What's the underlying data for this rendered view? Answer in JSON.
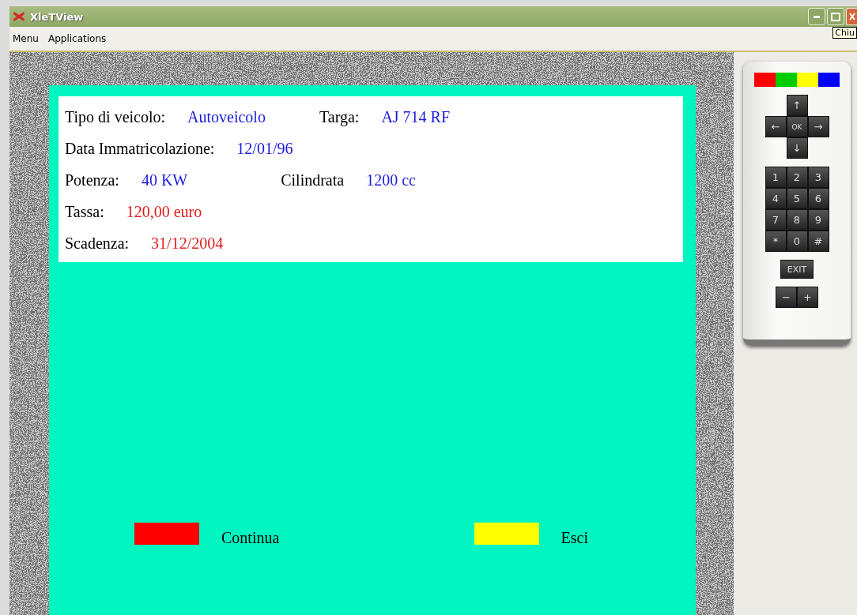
{
  "window": {
    "title": "XleTView",
    "tooltip": "Chiu"
  },
  "menu_bar": [
    "Menu",
    "Applications"
  ],
  "vehicle_info": [
    {
      "fields": [
        {
          "label": "Tipo di veicolo:",
          "value": "Autoveicolo",
          "color": "#1a1adc"
        },
        {
          "label": "Targa:",
          "value": "AJ 714 RF",
          "color": "#1a1adc"
        }
      ]
    },
    {
      "fields": [
        {
          "label": "Data Immatricolazione:",
          "value": "12/01/96",
          "color": "#1a1adc"
        }
      ]
    },
    {
      "fields": [
        {
          "label": "Potenza:",
          "value": "40 KW",
          "color": "#1a1adc"
        },
        {
          "label": "Cilindrata",
          "value": "1200 cc",
          "color": "#1a1adc"
        }
      ]
    },
    {
      "fields": [
        {
          "label": "Tassa:",
          "value": "120,00 euro",
          "color": "#e01a1a"
        }
      ]
    },
    {
      "fields": [
        {
          "label": "Scadenza:",
          "value": "31/12/2004",
          "color": "#e01a1a"
        }
      ]
    }
  ],
  "actions": [
    {
      "label": "Continua",
      "color": "#ff0000"
    },
    {
      "label": "Esci",
      "color": "#ffff00"
    }
  ],
  "remote": {
    "color_keys": [
      {
        "color": "#ff0000"
      },
      {
        "color": "#00cc00"
      },
      {
        "color": "#ffff00"
      },
      {
        "color": "#0000ff"
      }
    ],
    "dpad": {
      "up": "↑",
      "left": "←",
      "ok": "OK",
      "right": "→",
      "down": "↓"
    },
    "keypad": [
      "1",
      "2",
      "3",
      "4",
      "5",
      "6",
      "7",
      "8",
      "9",
      "*",
      "0",
      "#"
    ],
    "exit": "EXIT",
    "volume": [
      "−",
      "+"
    ]
  }
}
